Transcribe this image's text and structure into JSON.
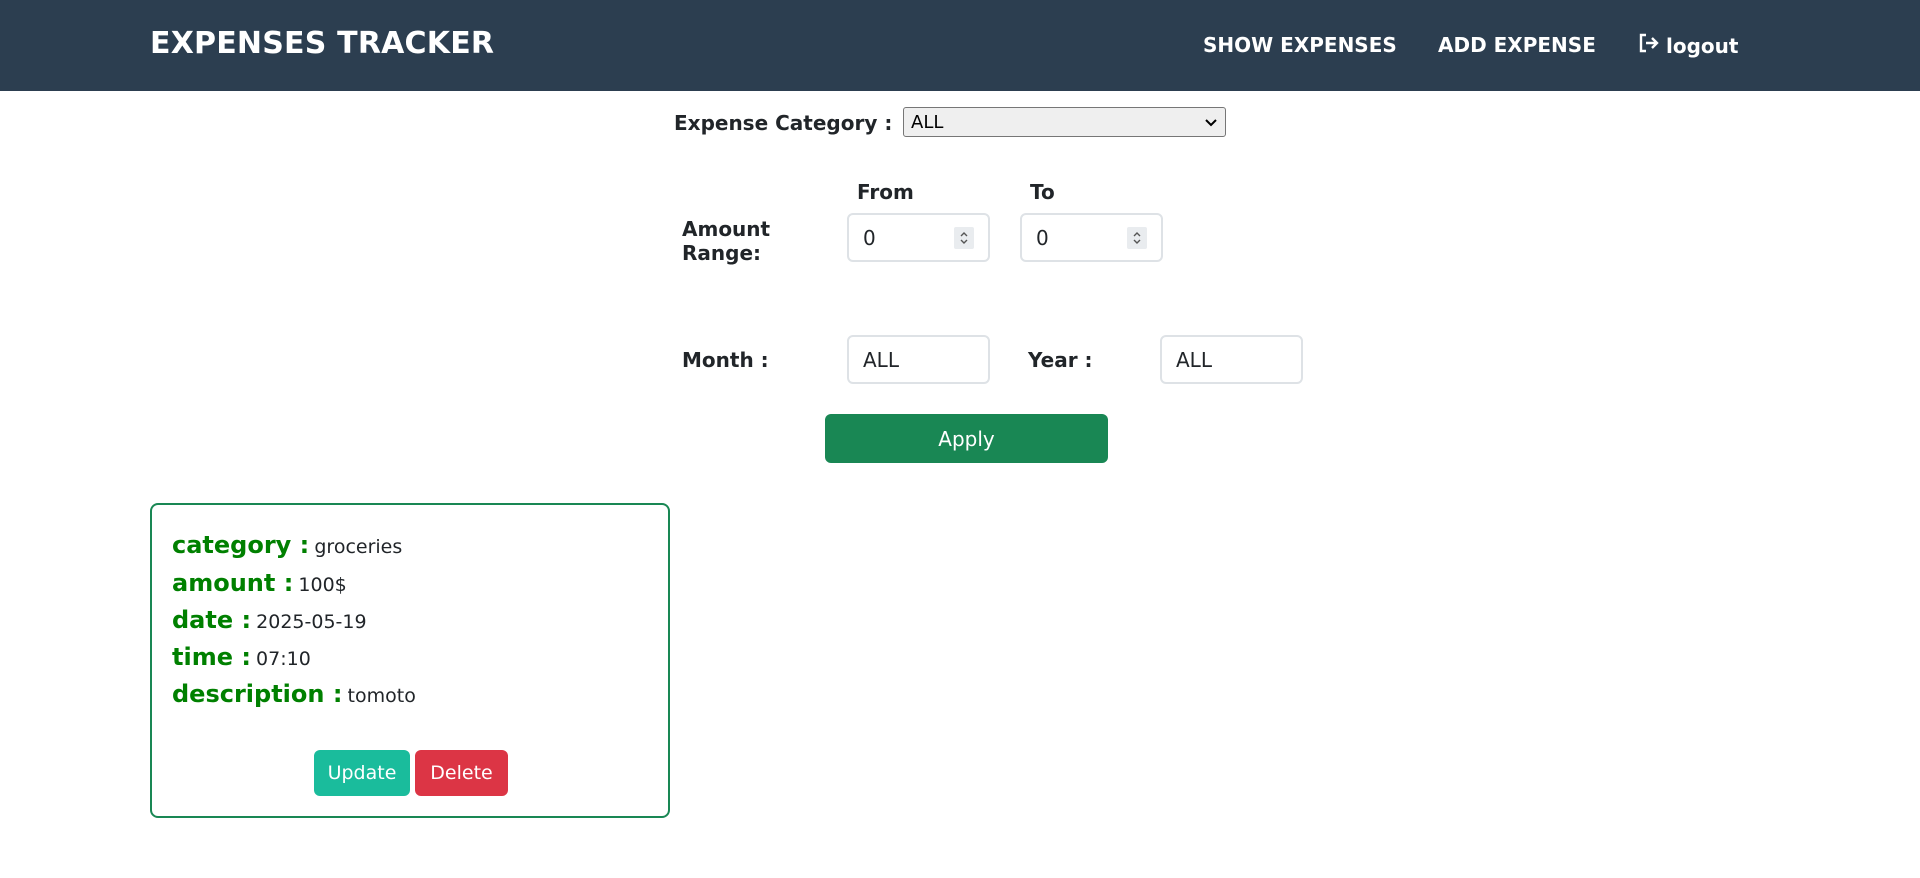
{
  "navbar": {
    "brand": "EXPENSES TRACKER",
    "show_expenses": "SHOW EXPENSES",
    "add_expense": "ADD EXPENSE",
    "logout": "logout"
  },
  "filters": {
    "category_label": "Expense Category :",
    "category_selected": "ALL",
    "amount_label": "Amount Range:",
    "from_label": "From",
    "to_label": "To",
    "from_value": "0",
    "to_value": "0",
    "month_label": "Month :",
    "month_value": "ALL",
    "year_label": "Year :",
    "year_value": "ALL",
    "apply_label": "Apply"
  },
  "expenses": [
    {
      "category_key": "category :",
      "category": "groceries",
      "amount_key": "amount :",
      "amount": "100$",
      "date_key": "date :",
      "date": "2025-05-19",
      "time_key": "time :",
      "time": "07:10",
      "description_key": "description :",
      "description": "tomoto",
      "update_label": "Update",
      "delete_label": "Delete"
    }
  ],
  "colors": {
    "navbar": "#2c3e50",
    "apply": "#198754",
    "update": "#1abc9c",
    "delete": "#dc3545",
    "card_key": "#008000"
  }
}
